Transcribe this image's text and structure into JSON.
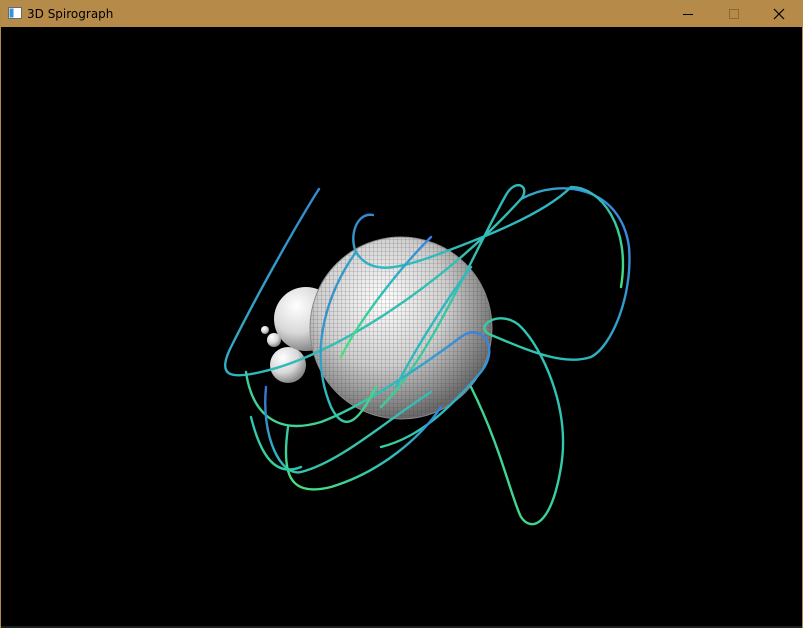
{
  "window": {
    "title": "3D Spirograph",
    "frame_color": "#b68b4a",
    "icons": {
      "app": "app-window-icon",
      "minimize": "minimize-icon",
      "maximize": "maximize-icon",
      "close": "close-icon"
    }
  },
  "scene": {
    "background": "#000000",
    "curve_colors": [
      "#3b6fd6",
      "#2aa6c8",
      "#3bd6a0",
      "#48e070"
    ],
    "sphere_color": "#dcdcdc"
  }
}
